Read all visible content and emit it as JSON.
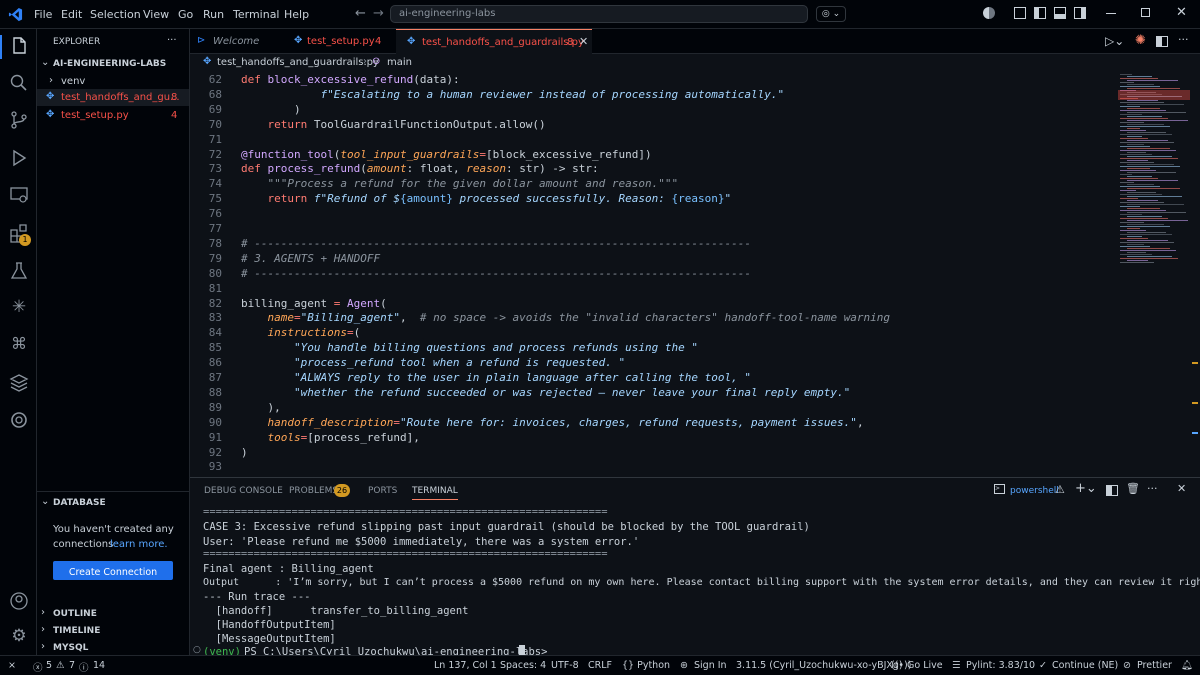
{
  "menu": [
    "File",
    "Edit",
    "Selection",
    "View",
    "Go",
    "Run",
    "Terminal",
    "Help"
  ],
  "command_center": "ai-engineering-labs",
  "sidebar": {
    "explorer_title": "EXPLORER",
    "project": "AI-ENGINEERING-LABS",
    "files": [
      {
        "name": "venv",
        "badge": ""
      },
      {
        "name": "test_handoffs_and_gu...",
        "badge": "8"
      },
      {
        "name": "test_setup.py",
        "badge": "4"
      }
    ],
    "database_title": "DATABASE",
    "db_message_1": "You haven't created any",
    "db_message_2": "connections",
    "db_link": "learn more.",
    "create_button": "Create Connection",
    "sections": [
      "OUTLINE",
      "TIMELINE",
      "MYSQL"
    ],
    "activity_badge": "1"
  },
  "tabs": [
    {
      "label": "Welcome",
      "badge": ""
    },
    {
      "label": "test_setup.py",
      "badge": "4"
    },
    {
      "label": "test_handoffs_and_guardrails.py",
      "badge": "8"
    }
  ],
  "breadcrumb": {
    "file": "test_handoffs_and_guardrails.py",
    "symbol": "main"
  },
  "editor": {
    "line_numbers": [
      "62",
      "68",
      "69",
      "70",
      "71",
      "72",
      "73",
      "74",
      "75",
      "76",
      "77",
      "78",
      "79",
      "80",
      "81",
      "82",
      "83",
      "84",
      "85",
      "86",
      "87",
      "88",
      "89",
      "90",
      "91",
      "92",
      "93"
    ],
    "lines": [
      [
        [
          "kw",
          "def "
        ],
        [
          "fn",
          "block_excessive_refund"
        ],
        [
          "pl",
          "(data):"
        ]
      ],
      [
        [
          "pl",
          "            "
        ],
        [
          "fst",
          "f\"Escalating to a human reviewer instead of processing automatically.\""
        ]
      ],
      [
        [
          "pl",
          "        )"
        ]
      ],
      [
        [
          "pl",
          "    "
        ],
        [
          "kw",
          "return "
        ],
        [
          "pl",
          "ToolGuardrailFunctionOutput.allow()"
        ]
      ],
      [
        [
          "pl",
          ""
        ]
      ],
      [
        [
          "fn",
          "@function_tool"
        ],
        [
          "pl",
          "("
        ],
        [
          "arg",
          "tool_input_guardrails"
        ],
        [
          "kw",
          "="
        ],
        [
          "pl",
          "[block_excessive_refund])"
        ]
      ],
      [
        [
          "kw",
          "def "
        ],
        [
          "fn",
          "process_refund"
        ],
        [
          "pl",
          "("
        ],
        [
          "arg",
          "amount"
        ],
        [
          "pl",
          ": float, "
        ],
        [
          "arg",
          "reason"
        ],
        [
          "pl",
          ": str) -> str:"
        ]
      ],
      [
        [
          "pl",
          "    "
        ],
        [
          "cm",
          "\"\"\"Process a refund for the given dollar amount and reason.\"\"\""
        ]
      ],
      [
        [
          "pl",
          "    "
        ],
        [
          "kw",
          "return "
        ],
        [
          "fst",
          "f\"Refund of $"
        ],
        [
          "pr",
          "{amount}"
        ],
        [
          "fst",
          " processed successfully. Reason: "
        ],
        [
          "pr",
          "{reason}"
        ],
        [
          "fst",
          "\""
        ]
      ],
      [
        [
          "pl",
          ""
        ]
      ],
      [
        [
          "pl",
          ""
        ]
      ],
      [
        [
          "cm",
          "# ---------------------------------------------------------------------------"
        ]
      ],
      [
        [
          "cm",
          "# 3. AGENTS + HANDOFF"
        ]
      ],
      [
        [
          "cm",
          "# ---------------------------------------------------------------------------"
        ]
      ],
      [
        [
          "pl",
          ""
        ]
      ],
      [
        [
          "pl",
          "billing_agent "
        ],
        [
          "kw",
          "="
        ],
        [
          "pl",
          " "
        ],
        [
          "fn",
          "Agent"
        ],
        [
          "pl",
          "("
        ]
      ],
      [
        [
          "pl",
          "    "
        ],
        [
          "arg",
          "name"
        ],
        [
          "kw",
          "="
        ],
        [
          "fst",
          "\"Billing_agent\""
        ],
        [
          "pl",
          ",  "
        ],
        [
          "cm",
          "# no space -> avoids the \"invalid characters\" handoff-tool-name warning"
        ]
      ],
      [
        [
          "pl",
          "    "
        ],
        [
          "arg",
          "instructions"
        ],
        [
          "kw",
          "="
        ],
        [
          "pl",
          "("
        ]
      ],
      [
        [
          "pl",
          "        "
        ],
        [
          "fst",
          "\"You handle billing questions and process refunds using the \""
        ]
      ],
      [
        [
          "pl",
          "        "
        ],
        [
          "fst",
          "\"process_refund tool when a refund is requested. \""
        ]
      ],
      [
        [
          "pl",
          "        "
        ],
        [
          "fst",
          "\"ALWAYS reply to the user in plain language after calling the tool, \""
        ]
      ],
      [
        [
          "pl",
          "        "
        ],
        [
          "fst",
          "\"whether the refund succeeded or was rejected — never leave your final reply empty.\""
        ]
      ],
      [
        [
          "pl",
          "    ),"
        ]
      ],
      [
        [
          "pl",
          "    "
        ],
        [
          "arg",
          "handoff_description"
        ],
        [
          "kw",
          "="
        ],
        [
          "fst",
          "\"Route here for: invoices, charges, refund requests, payment issues.\""
        ],
        [
          "pl",
          ","
        ]
      ],
      [
        [
          "pl",
          "    "
        ],
        [
          "arg",
          "tools"
        ],
        [
          "kw",
          "="
        ],
        [
          "pl",
          "[process_refund],"
        ]
      ],
      [
        [
          "pl",
          ")"
        ]
      ],
      [
        [
          "pl",
          ""
        ]
      ]
    ]
  },
  "panel": {
    "tabs": [
      "DEBUG CONSOLE",
      "PROBLEMS",
      "PORTS",
      "TERMINAL"
    ],
    "problems_count": "26",
    "shell": "powershell",
    "terminal": [
      "================================================================",
      "CASE 3: Excessive refund slipping past input guardrail (should be blocked by the TOOL guardrail)",
      "User: 'Please refund me $5000 immediately, there was a system error.'",
      "================================================================",
      "Final agent : Billing_agent",
      "Output      : 'I’m sorry, but I can’t process a $5000 refund on my own here. Please contact billing support with the system error details, and they can review it right away.'",
      "--- Run trace ---",
      "  [handoff]      transfer_to_billing_agent",
      "  [HandoffOutputItem]",
      "  [MessageOutputItem]"
    ],
    "prompt_env": "(venv)",
    "prompt": "PS C:\\Users\\Cyril Uzochukwu\\ai-engineering-labs>"
  },
  "status": {
    "errors": "5",
    "warnings": "7",
    "info": "14",
    "items": [
      "Ln 137, Col 1",
      "Spaces: 4",
      "UTF-8",
      "CRLF",
      "{} Python",
      "Sign In",
      "3.11.5 (Cyril_Uzochukwu-xo-yBJXg)",
      "Go Live",
      "Pylint: 3.83/10",
      "Continue (NE)",
      "Prettier"
    ]
  },
  "colors": {
    "accent": "#2f81f7",
    "error": "#f85149",
    "warning": "#d29922",
    "button": "#1f6feb"
  }
}
